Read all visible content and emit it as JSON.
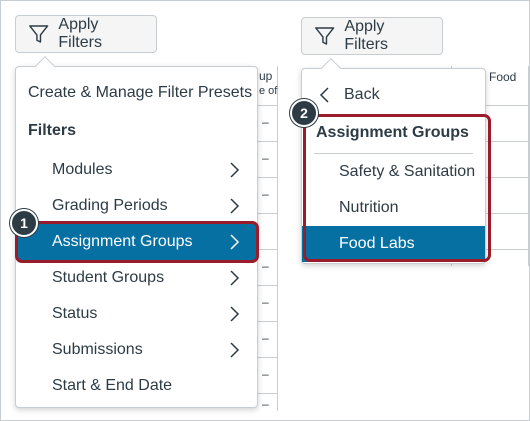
{
  "left_panel": {
    "apply_filters_label": "Apply Filters",
    "grid_header_text_1": "up",
    "grid_header_text_2": "e of",
    "menu": {
      "presets_label": "Create & Manage Filter Presets",
      "filters_heading": "Filters",
      "items": [
        {
          "label": "Modules",
          "has_submenu": true
        },
        {
          "label": "Grading Periods",
          "has_submenu": true
        },
        {
          "label": "Assignment Groups",
          "has_submenu": true,
          "selected": true
        },
        {
          "label": "Student Groups",
          "has_submenu": true
        },
        {
          "label": "Status",
          "has_submenu": true
        },
        {
          "label": "Submissions",
          "has_submenu": true
        },
        {
          "label": "Start & End Date",
          "has_submenu": false
        }
      ]
    },
    "callout_number": "1"
  },
  "right_panel": {
    "apply_filters_label": "Apply Filters",
    "grid_header_text": "Food",
    "menu": {
      "back_label": "Back",
      "group_heading": "Assignment Groups",
      "items": [
        {
          "label": "Safety & Sanitation",
          "selected": false
        },
        {
          "label": "Nutrition",
          "selected": false
        },
        {
          "label": "Food Labs",
          "selected": true
        }
      ]
    },
    "callout_number": "2"
  },
  "colors": {
    "selected_bg": "#0770a3",
    "highlight_border": "#9a1b2a",
    "badge_bg": "#2d3b45",
    "text": "#2d3b45",
    "border": "#c7cdd1"
  },
  "icons": [
    "funnel-icon",
    "chevron-right-icon",
    "chevron-left-icon"
  ]
}
